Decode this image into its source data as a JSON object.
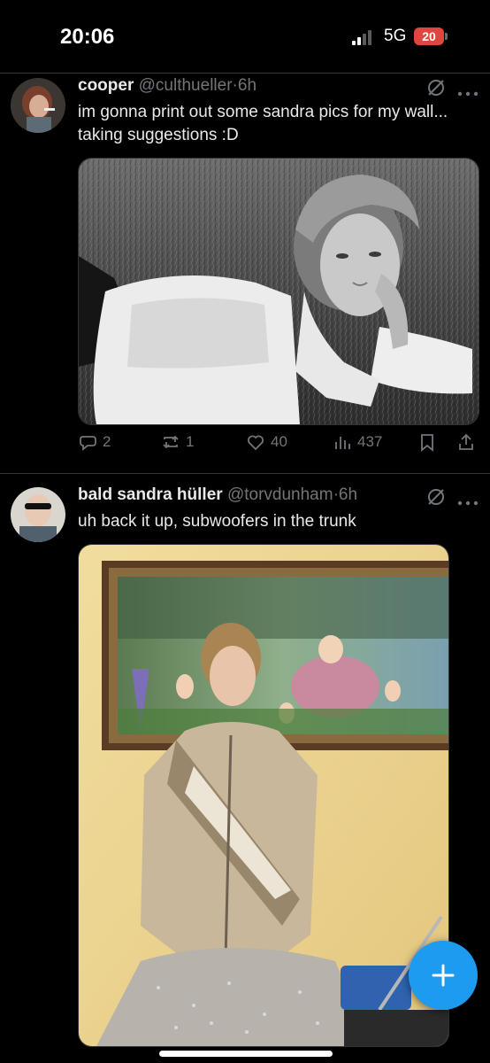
{
  "status_bar": {
    "time": "20:06",
    "network": "5G",
    "battery": "20"
  },
  "tweets": [
    {
      "name": "cooper",
      "handle": "@culthueller",
      "separator": "·",
      "time": "6h",
      "text": "im gonna print out some sandra pics for my wall... taking suggestions :D",
      "media_description": "Black-and-white photo of a woman in a white shirt lying on grass, resting her head on her hand",
      "replies": "2",
      "reposts": "1",
      "likes": "40",
      "views": "437"
    },
    {
      "name": "bald sandra hüller",
      "handle": "@torvdunham",
      "separator": "·",
      "time": "6h",
      "text": "uh back it up, subwoofers in the trunk",
      "media_description": "Woman in a beige shearling jacket and sequined skirt standing in front of a framed painting on a yellow wall"
    }
  ],
  "icons": {
    "grok": "grok-icon",
    "more": "more-icon",
    "reply": "reply-icon",
    "repost": "repost-icon",
    "like": "like-icon",
    "views": "views-icon",
    "bookmark": "bookmark-icon",
    "share": "share-icon",
    "compose": "compose-plus-icon"
  },
  "colors": {
    "background": "#000000",
    "text": "#e7e9ea",
    "muted": "#71767b",
    "accent": "#1d9bf0",
    "battery": "#e0463f"
  }
}
